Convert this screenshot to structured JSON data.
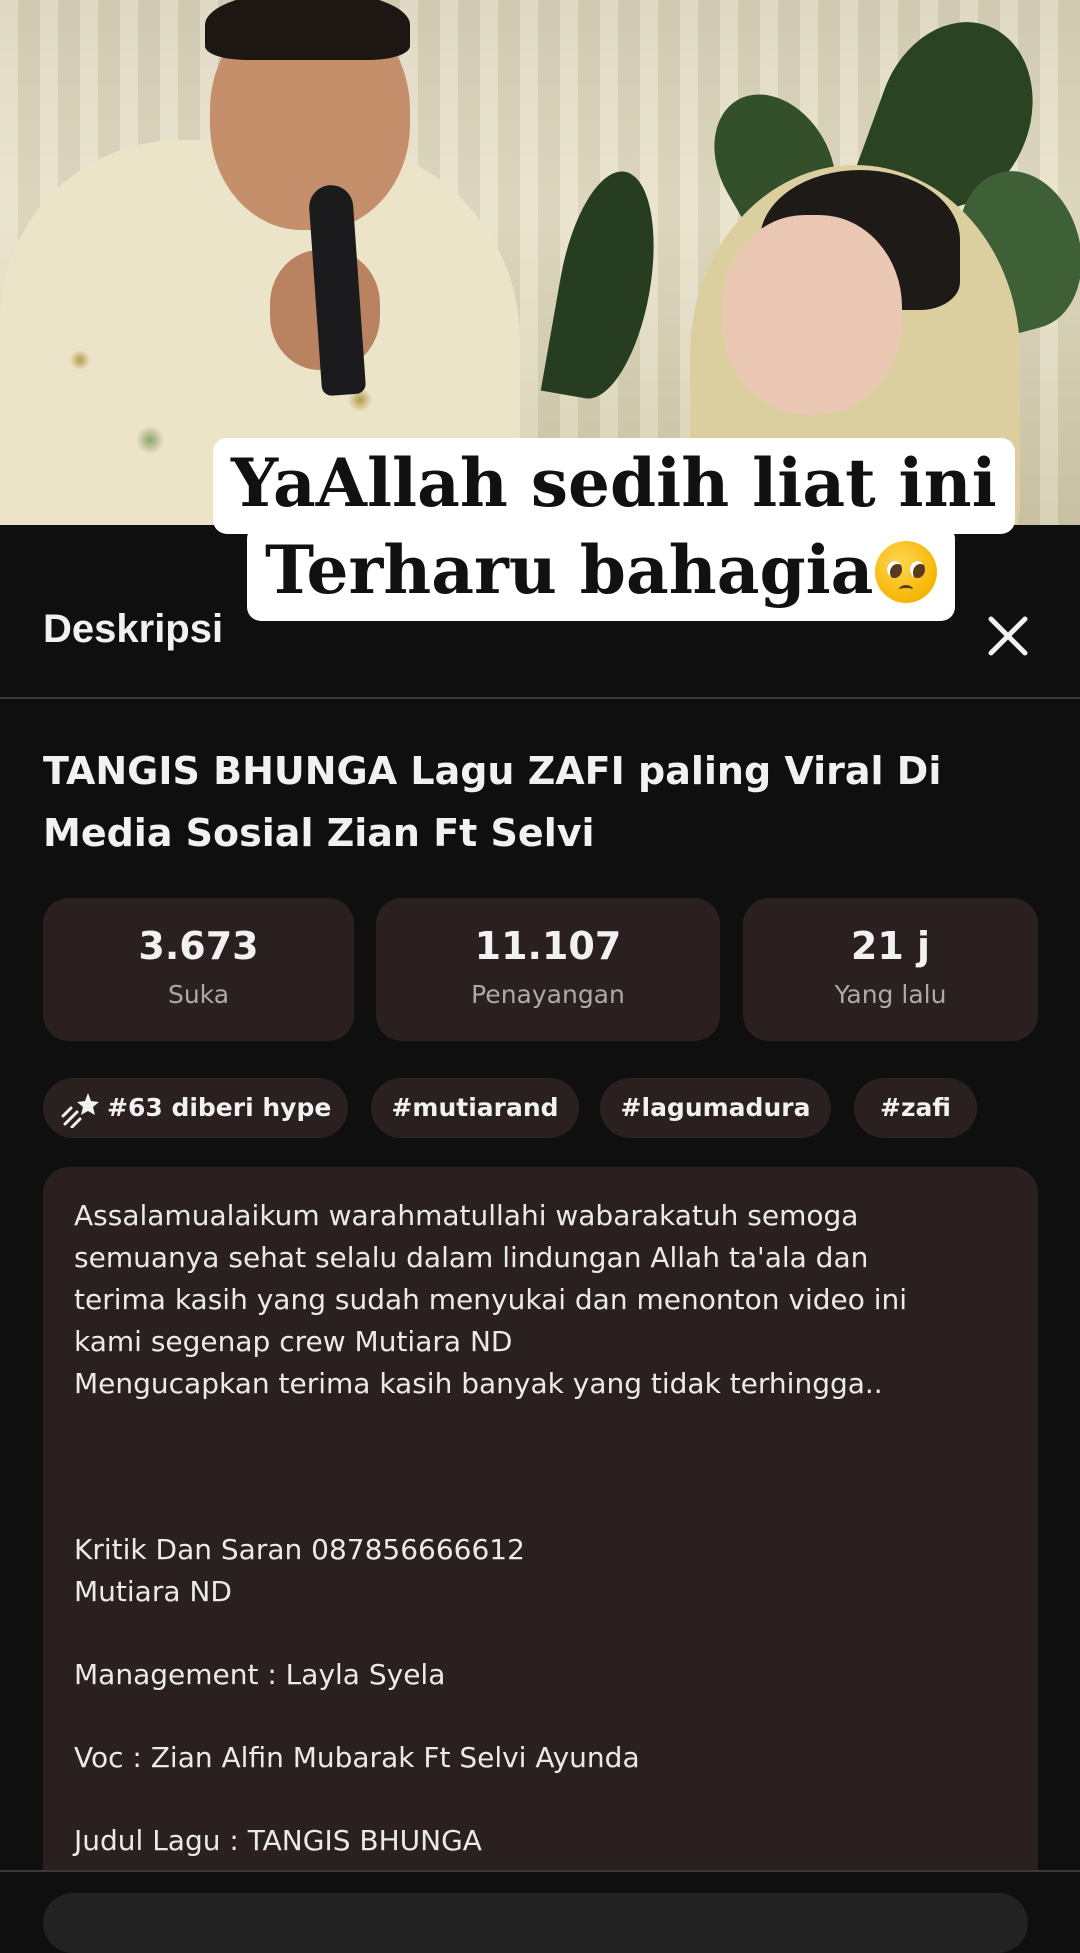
{
  "video": {
    "caption_line1": "YaAllah sedih liat ini",
    "caption_line2": "Terharu bahagia",
    "caption_emoji": "pleading-face-emoji"
  },
  "panel": {
    "title": "Deskripsi",
    "close_icon": "close-icon"
  },
  "video_title": "TANGIS BHUNGA Lagu ZAFI paling Viral Di Media Sosial Zian Ft Selvi",
  "stats": [
    {
      "value": "3.673",
      "label": "Suka"
    },
    {
      "value": "11.107",
      "label": "Penayangan"
    },
    {
      "value": "21 j",
      "label": "Yang lalu"
    }
  ],
  "chips": {
    "hype": "#63 diberi hype",
    "hype_icon": "hype-icon",
    "tags": [
      "#mutiarand",
      "#lagumadura",
      "#zafi"
    ]
  },
  "description": [
    "Assalamualaikum warahmatullahi wabarakatuh semoga",
    "semuanya sehat selalu dalam lindungan Allah ta'ala dan",
    "terima kasih yang sudah menyukai dan menonton video ini",
    "kami segenap crew Mutiara ND",
    "Mengucapkan terima kasih banyak yang tidak terhingga..",
    "",
    "",
    "Kritik Dan Saran 087856666612",
    "Mutiara ND",
    "",
    "Management : Layla Syela",
    "",
    "Voc : Zian Alfin Mubarak Ft Selvi Ayunda",
    "",
    "Judul Lagu : TANGIS BHUNGA"
  ],
  "colors": {
    "background": "#0f0f0f",
    "card": "#2b2020",
    "text": "#f1f1f1",
    "muted": "#aaaaaa"
  }
}
